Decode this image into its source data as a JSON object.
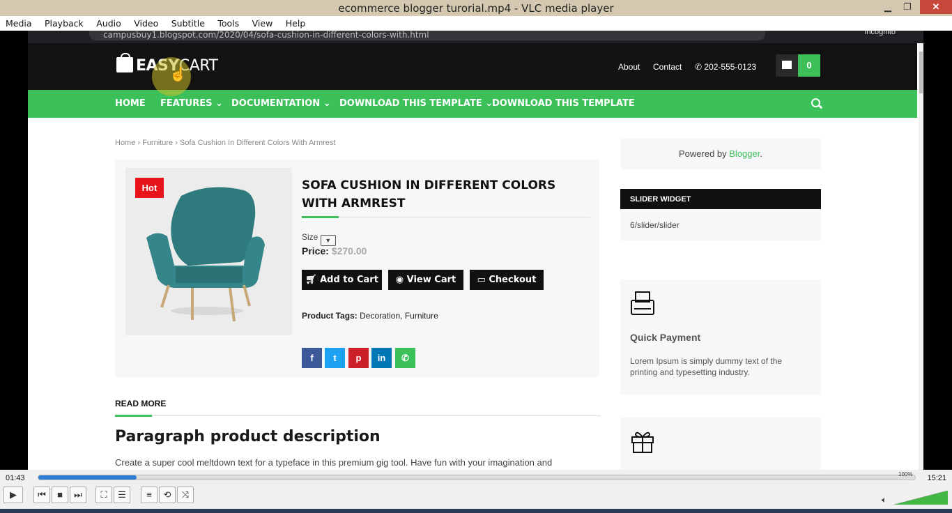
{
  "window": {
    "title": "ecommerce blogger turorial.mp4 - VLC media player",
    "minimize": "▁",
    "maximize": "❐",
    "close": "✕"
  },
  "menu": [
    "Media",
    "Playback",
    "Audio",
    "Video",
    "Subtitle",
    "Tools",
    "View",
    "Help"
  ],
  "browser": {
    "url": "campusbuy1.blogspot.com/2020/04/sofa-cushion-in-different-colors-with.html",
    "incognito": "Incognito"
  },
  "site": {
    "logo_bold": "EASY",
    "logo_light": "CART",
    "top_links": {
      "about": "About",
      "contact": "Contact",
      "phone": "202-555-0123"
    },
    "cart_count": "0",
    "nav": [
      "HOME",
      "FEATURES ⌄",
      "DOCUMENTATION ⌄",
      "DOWNLOAD THIS TEMPLATE ⌄",
      "DOWNLOAD THIS TEMPLATE"
    ],
    "breadcrumb": "Home › Furniture › Sofa Cushion In Different Colors With Armrest",
    "product": {
      "badge": "Hot",
      "title": "SOFA CUSHION IN DIFFERENT COLORS WITH ARMREST",
      "size_label": "Size",
      "price_label": "Price:",
      "price_value": "$270.00",
      "buttons": {
        "add": "Add to Cart",
        "view": "View Cart",
        "checkout": "Checkout"
      },
      "tags_label": "Product Tags:",
      "tags_value": "Decoration, Furniture"
    },
    "read_more": "READ MORE",
    "heading": "Paragraph product description",
    "paragraph": "Create a super cool meltdown text for a typeface in this premium gig tool. Have fun with your imagination and",
    "sidebar": {
      "powered_prefix": "Powered by ",
      "powered_link": "Blogger",
      "powered_suffix": ".",
      "widget_title": "SLIDER WIDGET",
      "widget_body": "6/slider/slider",
      "feature_title": "Quick Payment",
      "feature_text": "Lorem Ipsum is simply dummy text of the printing and typesetting industry."
    }
  },
  "player": {
    "elapsed": "01:43",
    "total": "15:21",
    "progress": 0.112,
    "volume": "100%",
    "volume_level": 1.0
  },
  "colors": {
    "accent": "#3cc05a",
    "dark": "#121212",
    "hot": "#e8141c",
    "facebook": "#3b5998",
    "twitter": "#1da1f2",
    "pinterest": "#cb2027",
    "linkedin": "#0077b5",
    "whatsapp": "#3cc05a"
  }
}
